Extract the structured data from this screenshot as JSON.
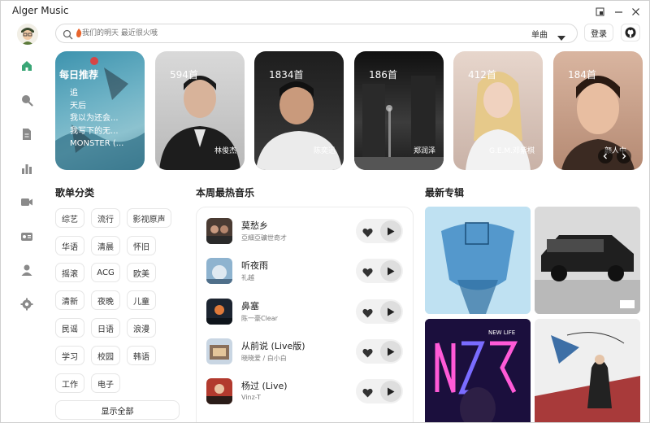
{
  "app": {
    "title": "Alger Music"
  },
  "search": {
    "placeholder": "我们的明天 最近很火哦",
    "type_label": "单曲"
  },
  "header": {
    "login_label": "登录"
  },
  "cards": {
    "daily": {
      "title": "每日推荐",
      "songs": [
        "追",
        "天后",
        "我以为还会...",
        "我写下的无...",
        "MONSTER (..."
      ]
    },
    "playlists": [
      {
        "count": "594首",
        "artist": "林俊杰"
      },
      {
        "count": "1834首",
        "artist": "陈奕迅"
      },
      {
        "count": "186首",
        "artist": "郑润泽"
      },
      {
        "count": "412首",
        "artist": "G.E.M.邓紫棋"
      },
      {
        "count": "184首",
        "artist": "颜人中"
      }
    ]
  },
  "categories": {
    "title": "歌单分类",
    "items": [
      "综艺",
      "流行",
      "影视原声",
      "华语",
      "清晨",
      "怀旧",
      "摇滚",
      "ACG",
      "欧美",
      "清新",
      "夜晚",
      "儿童",
      "民谣",
      "日语",
      "浪漫",
      "学习",
      "校园",
      "韩语",
      "工作",
      "电子"
    ],
    "show_all": "显示全部"
  },
  "hot": {
    "title": "本周最热音乐",
    "songs": [
      {
        "name": "莫愁乡",
        "artist": "亞細亞礦世奇才"
      },
      {
        "name": "听夜雨",
        "artist": "礼越"
      },
      {
        "name": "鼻塞",
        "artist": "陈一豪Clear"
      },
      {
        "name": "从前说 (Live版)",
        "artist": "晓晓爱 / 白小白"
      },
      {
        "name": "杨过 (Live)",
        "artist": "Vinz-T"
      }
    ]
  },
  "albums": {
    "title": "最新专辑",
    "album3_text": "NEW LIFE"
  },
  "colors": {
    "accent": "#3aa676",
    "text": "#222222",
    "muted": "#777777"
  },
  "icons": [
    "home-icon",
    "search-icon",
    "document-icon",
    "chart-icon",
    "video-icon",
    "radio-icon",
    "user-icon",
    "settings-icon",
    "github-icon",
    "heart-icon",
    "play-icon"
  ]
}
